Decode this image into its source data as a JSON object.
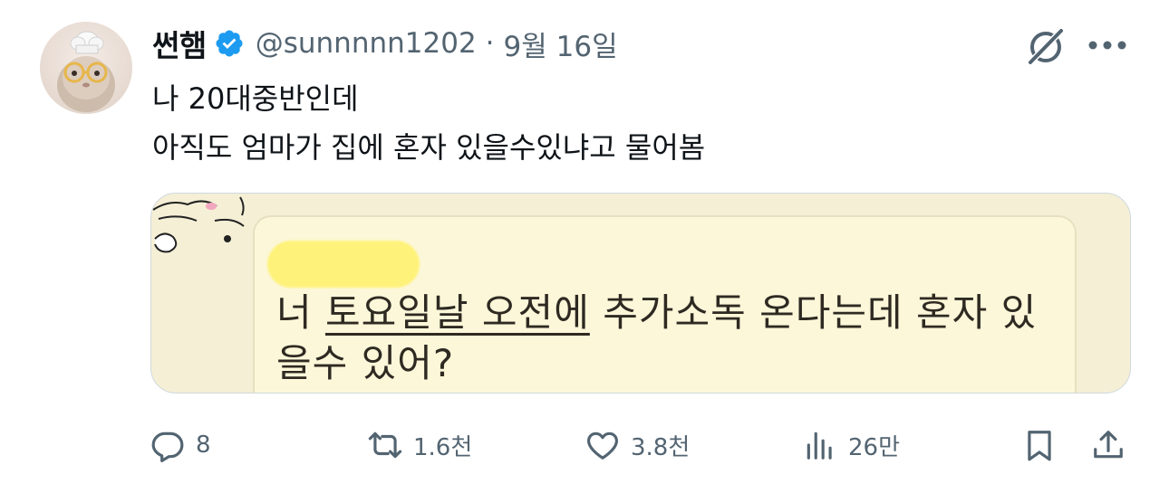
{
  "tweet": {
    "display_name": "썬햄",
    "handle": "@sunnnnn1202",
    "separator": "·",
    "timestamp": "9월 16일",
    "text_line1": "나 20대중반인데",
    "text_line2": "아직도 엄마가 집에 혼자 있을수있냐고 물어봄"
  },
  "media": {
    "message_part1": "너 ",
    "message_underlined": "토요일날 오전에",
    "message_part2": " 추가소독 온다는데 혼자 있",
    "message_line2": "을수 있어?"
  },
  "actions": {
    "reply_count": "8",
    "retweet_count": "1.6천",
    "like_count": "3.8천",
    "views_count": "26만"
  },
  "icons": {
    "verified": "verified-badge-icon",
    "grok": "grok-icon",
    "more": "more-icon",
    "reply": "reply-icon",
    "retweet": "retweet-icon",
    "like": "heart-icon",
    "views": "views-icon",
    "bookmark": "bookmark-icon",
    "share": "share-icon"
  },
  "colors": {
    "verified_blue": "#1d9bf0",
    "secondary_text": "#536471",
    "primary_text": "#0f1419"
  }
}
